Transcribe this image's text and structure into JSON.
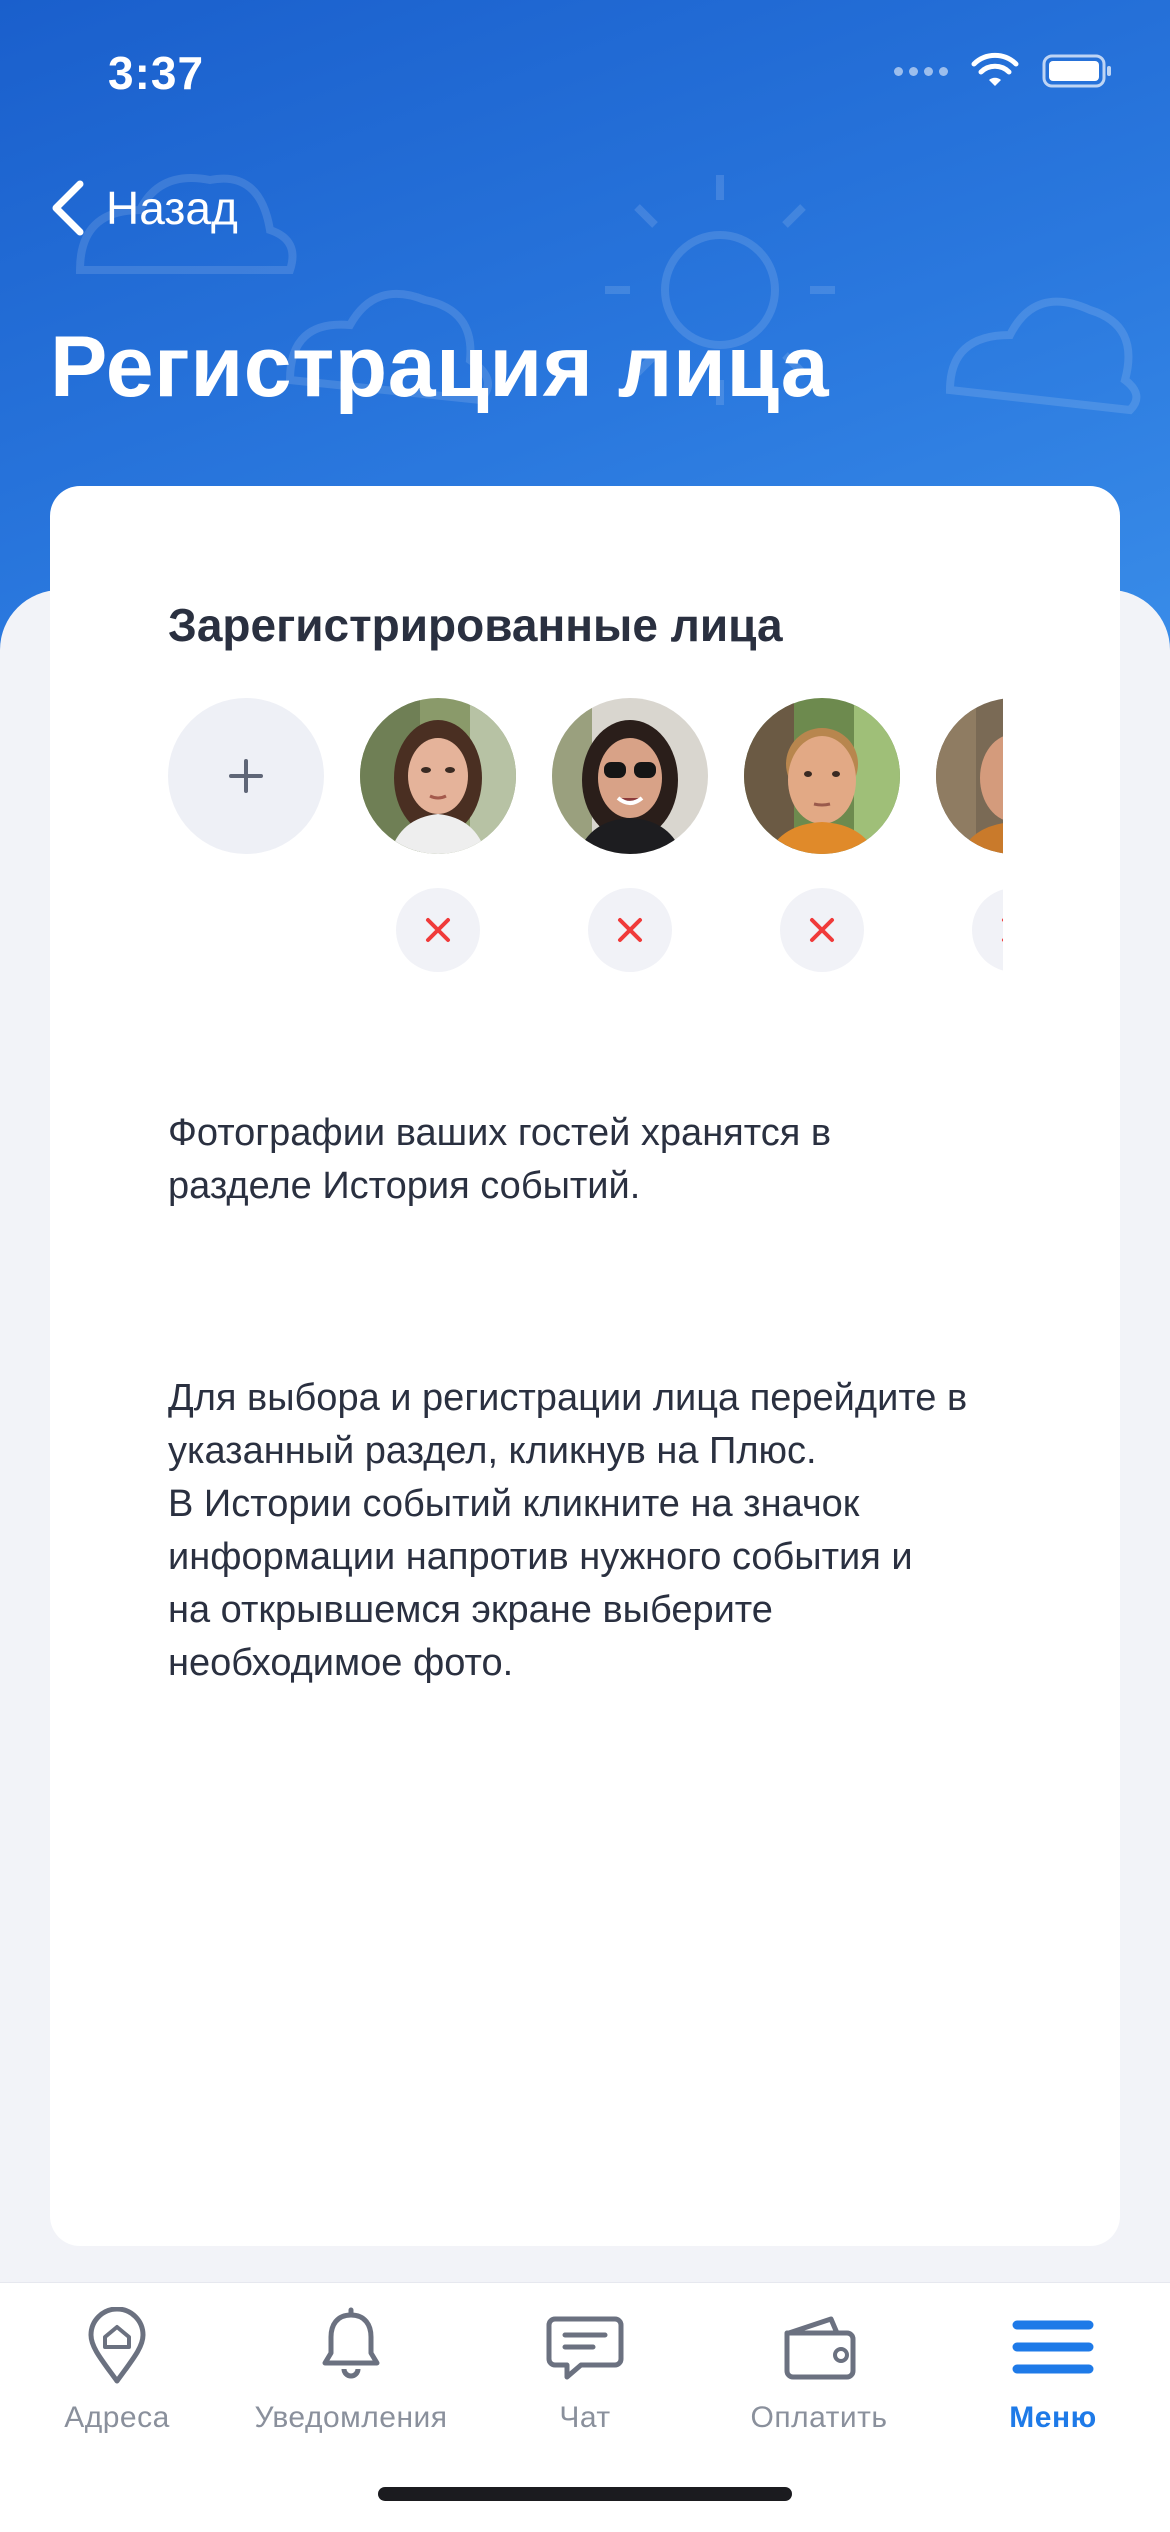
{
  "status_bar": {
    "time": "3:37"
  },
  "nav": {
    "back_label": "Назад",
    "title": "Регистрация лица"
  },
  "faces_section": {
    "title": "Зарегистрированные лица",
    "faces": [
      {
        "id": "face-1"
      },
      {
        "id": "face-2"
      },
      {
        "id": "face-3"
      },
      {
        "id": "face-4"
      }
    ]
  },
  "info": {
    "paragraph1": "Фотографии ваших гостей хранятся в\nразделе История событий.",
    "paragraph2": "Для выбора и регистрации лица перейдите в\nуказанный раздел, кликнув на Плюс.\nВ Истории событий кликните на значок\nинформации напротив нужного события и\nна открывшемся экране выберите\nнеобходимое фото."
  },
  "tab_bar": {
    "items": [
      {
        "label": "Адреса",
        "icon": "location-home-icon"
      },
      {
        "label": "Уведомления",
        "icon": "bell-icon"
      },
      {
        "label": "Чат",
        "icon": "chat-icon"
      },
      {
        "label": "Оплатить",
        "icon": "wallet-icon"
      },
      {
        "label": "Меню",
        "icon": "menu-icon",
        "active": true
      }
    ]
  },
  "colors": {
    "accent": "#1E7AE8",
    "header": "#1A5FCC",
    "remove": "#F03A3A"
  }
}
